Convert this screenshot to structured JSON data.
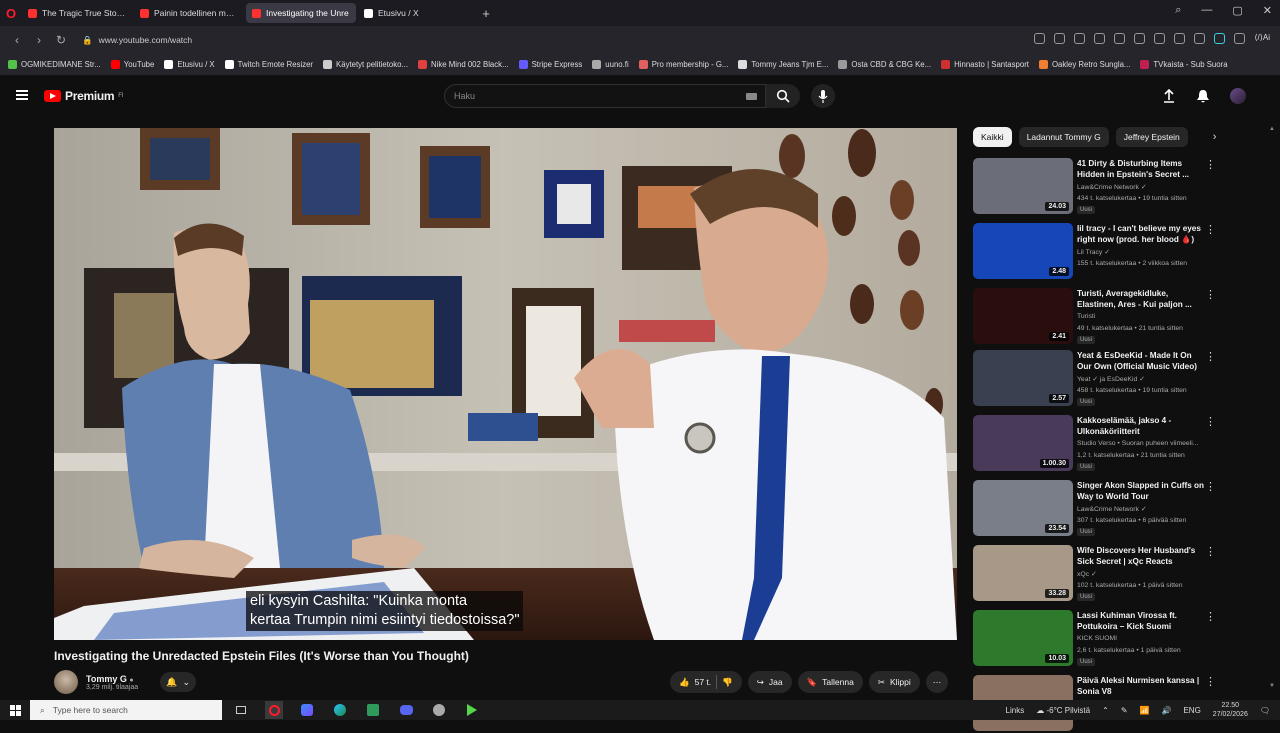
{
  "browser": {
    "tabs": [
      {
        "label": "The Tragic True Story of Ju",
        "color": "#ff3030"
      },
      {
        "label": "Painin todellinen merkity",
        "color": "#ff3030"
      },
      {
        "label": "Investigating the Unre",
        "color": "#ff3030",
        "active": true
      },
      {
        "label": "Etusivu / X",
        "color": "#ffffff"
      }
    ],
    "url": "www.youtube.com/watch",
    "bookmarks": [
      {
        "label": "OGMIKEDIMANE Str...",
        "color": "#53c24a"
      },
      {
        "label": "YouTube",
        "color": "#ff0000"
      },
      {
        "label": "Etusivu / X",
        "color": "#ffffff"
      },
      {
        "label": "Twitch Emote Resizer",
        "color": "#ffffff"
      },
      {
        "label": "Käytetyt pelitietoko...",
        "color": "#cccccc"
      },
      {
        "label": "Nike Mind 002 Black...",
        "color": "#e04040"
      },
      {
        "label": "Stripe Express",
        "color": "#635bff"
      },
      {
        "label": "uuno.fi",
        "color": "#aaaaaa"
      },
      {
        "label": "Pro membership - G...",
        "color": "#e06060"
      },
      {
        "label": "Tommy Jeans Tjm E...",
        "color": "#dddddd"
      },
      {
        "label": "Osta CBD & CBG Ke...",
        "color": "#999999"
      },
      {
        "label": "Hinnasto | Santasport",
        "color": "#d03030"
      },
      {
        "label": "Oakley Retro Sungla...",
        "color": "#f08030"
      },
      {
        "label": "TVkaista - Sub Suora",
        "color": "#c02050"
      }
    ],
    "ai_label": "Aria"
  },
  "youtube": {
    "logo": "Premium",
    "logo_sup": "FI",
    "search_placeholder": "Haku",
    "caption_line1": "eli kysyin Cashilta: \"Kuinka monta",
    "caption_line2": "kertaa Trumpin nimi esiintyi tiedostoissa?\"",
    "title": "Investigating the Unredacted Epstein Files (It's Worse than You Thought)",
    "channel": {
      "name": "Tommy G",
      "subs": "3,29 milj. tilaajaa"
    },
    "likes": "57 t.",
    "share": "Jaa",
    "save": "Tallenna",
    "clip": "Klippi",
    "chips": [
      "Kaikki",
      "Ladannut Tommy G",
      "Jeffrey Epstein"
    ]
  },
  "recommendations": [
    {
      "title": "41 Dirty & Disturbing Items Hidden in Epstein's Secret ...",
      "channel": "Law&Crime Network ✓",
      "meta": "434 t. katselukertaa • 19 tuntia sitten",
      "duration": "24.03",
      "badge": "Uusi",
      "thumb": "#6b6e78"
    },
    {
      "title": "lil tracy - I can't believe my eyes right now (prod. her blood 🩸)",
      "channel": "Lil Tracy ✓",
      "meta": "155 t. katselukertaa • 2 viikkoa sitten",
      "duration": "2.48",
      "badge": "",
      "thumb": "#1646b8"
    },
    {
      "title": "Turisti, Averagekidluke, Elastinen, Ares - Kui paljon ...",
      "channel": "Turisti",
      "meta": "49 t. katselukertaa • 21 tuntia sitten",
      "duration": "2.41",
      "badge": "Uusi",
      "thumb": "#2a0d0d"
    },
    {
      "title": "Yeat & EsDeeKid - Made It On Our Own (Official Music Video)",
      "channel": "Yeat ✓ ja EsDeeKid ✓",
      "meta": "458 t. katselukertaa • 19 tuntia sitten",
      "duration": "2.57",
      "badge": "Uusi",
      "thumb": "#3a4050"
    },
    {
      "title": "Kakkoselämää, jakso 4 - Ulkonäköriitterit",
      "channel": "Studio Verso • Suoran puheen viimeeli...",
      "meta": "1,2 t. katselukertaa • 21 tuntia sitten",
      "duration": "1.00.30",
      "badge": "Uusi",
      "thumb": "#4a3a5a"
    },
    {
      "title": "Singer Akon Slapped in Cuffs on Way to World Tour",
      "channel": "Law&Crime Network ✓",
      "meta": "307 t. katselukertaa • 6 päivää sitten",
      "duration": "23.54",
      "badge": "Uusi",
      "thumb": "#7a7e88"
    },
    {
      "title": "Wife Discovers Her Husband's Sick Secret | xQc Reacts",
      "channel": "xQc ✓",
      "meta": "102 t. katselukertaa • 1 päivä sitten",
      "duration": "33.28",
      "badge": "Uusi",
      "thumb": "#a89888"
    },
    {
      "title": "Lassi Kuhiman Virossa ft. Pottukoira – Kick Suomi",
      "channel": "KICK SUOMI",
      "meta": "2,6 t. katselukertaa • 1 päivä sitten",
      "duration": "10.03",
      "badge": "Uusi",
      "thumb": "#2d7a2d"
    },
    {
      "title": "Päivä Aleksi Nurmisen kanssa | Sonia V8",
      "channel": "",
      "meta": "",
      "duration": "",
      "badge": "",
      "thumb": "#8a7060"
    }
  ],
  "taskbar": {
    "search": "Type here to search",
    "links": "Links",
    "weather": "-6°C  Pilvistä",
    "lang": "ENG",
    "time": "22.50",
    "date": "27/02/2026"
  }
}
